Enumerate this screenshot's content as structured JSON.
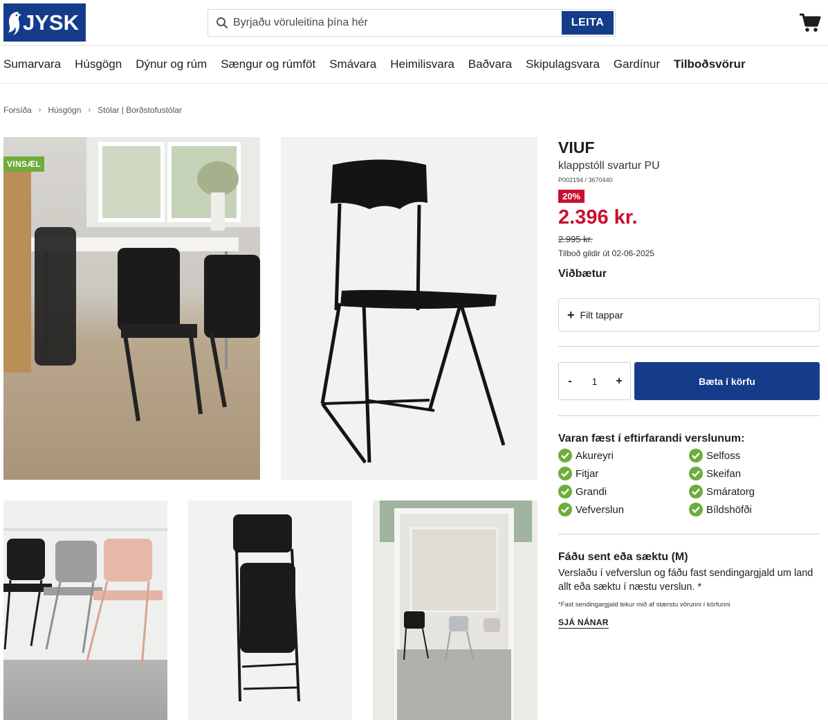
{
  "header": {
    "logo_text": "JYSK",
    "search_placeholder": "Byrjaðu vöruleitina þína hér",
    "search_button": "LEITA",
    "brand_color": "#143c8a"
  },
  "nav": {
    "items": [
      "Sumarvara",
      "Húsgögn",
      "Dýnur og rúm",
      "Sængur og rúmföt",
      "Smávara",
      "Heimilisvara",
      "Baðvara",
      "Skipulagsvara",
      "Gardínur",
      "Tilboðsvörur"
    ]
  },
  "breadcrumb": [
    "Forsíða",
    "Húsgögn",
    "Stólar | Borðstofustólar"
  ],
  "gallery": {
    "badge": "VINSÆL"
  },
  "product": {
    "brand": "VIUF",
    "description": "klappstóll svartur PU",
    "sku": "P002194 / 3670440",
    "discount": "20%",
    "price": "2.396 kr.",
    "old_price": "2.995 kr.",
    "offer_valid": "Tilboð gildir út 02-06-2025",
    "addons_title": "Viðbætur",
    "addon": "Filt tappar",
    "quantity": "1",
    "qty_minus": "-",
    "qty_plus": "+",
    "add_to_cart": "Bæta í körfu",
    "price_color": "#c8102e"
  },
  "stores": {
    "title": "Varan fæst í eftirfarandi verslunum:",
    "list": [
      "Akureyri",
      "Fitjar",
      "Grandi",
      "Vefverslun",
      "Selfoss",
      "Skeifan",
      "Smáratorg",
      "Bíldshöfði"
    ]
  },
  "shipping": {
    "title": "Fáðu sent eða sæktu (M)",
    "text": "Verslaðu í vefverslun og fáðu fast sendingargjald um land allt eða sæktu í næstu verslun. *",
    "note": "*Fast sendingargjald tekur mið af stærstu vörunni í körfunni",
    "link": "SJÁ NÁNAR"
  }
}
